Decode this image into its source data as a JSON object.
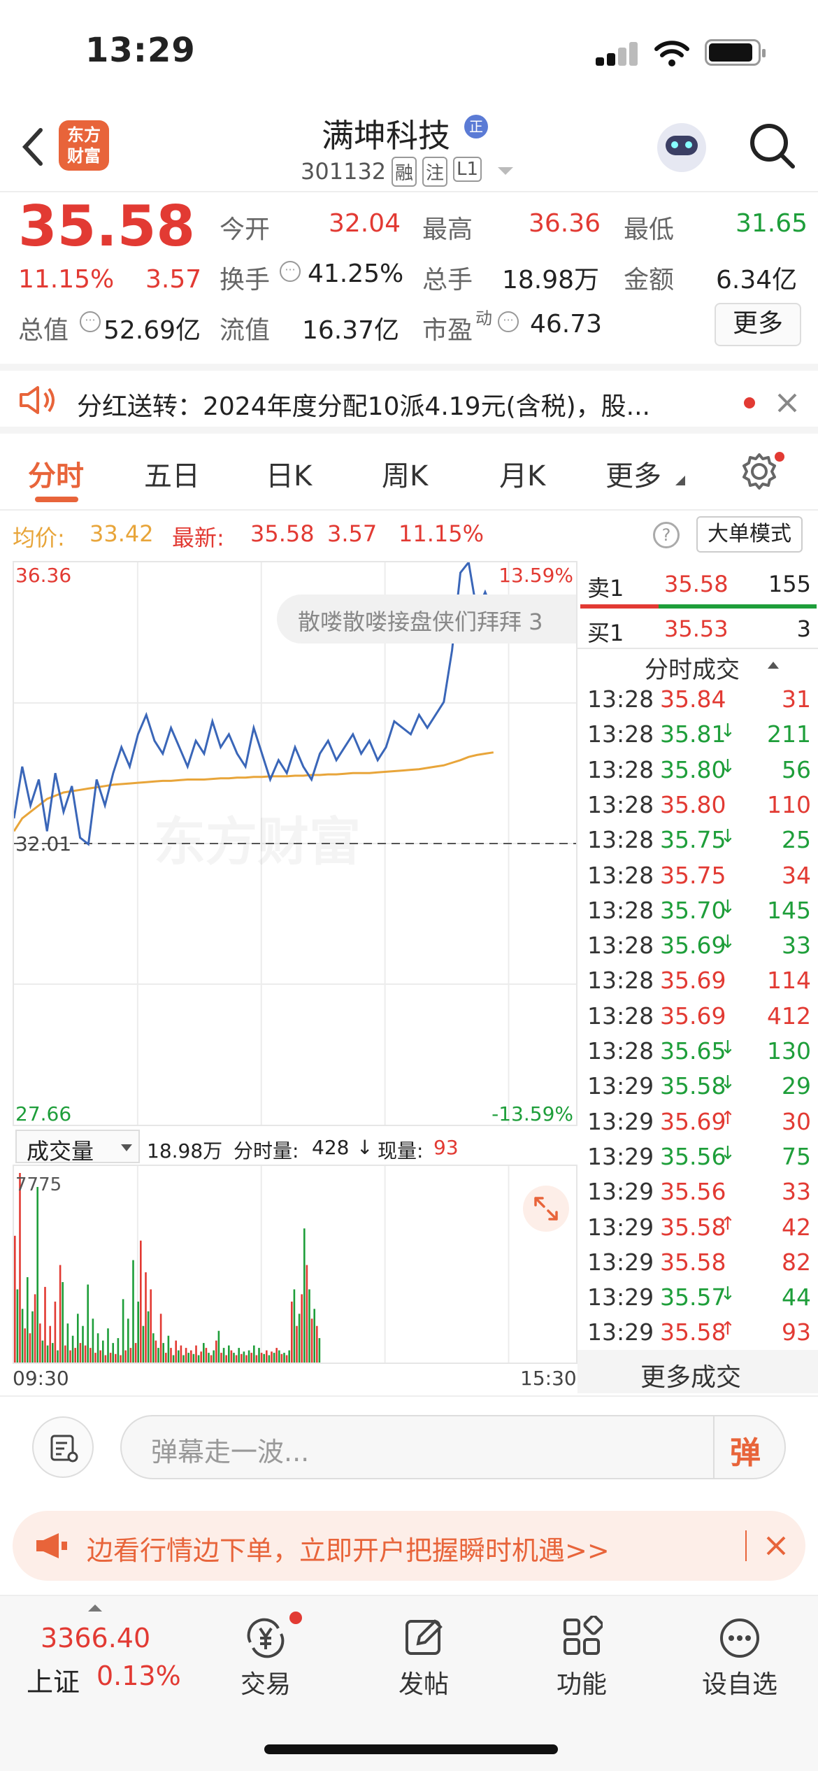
{
  "status_bar": {
    "time": "13:29"
  },
  "header": {
    "logo_text_line1": "东方",
    "logo_text_line2": "财富",
    "title": "满坤科技",
    "title_badge": "正",
    "code": "301132",
    "tags": [
      "融",
      "注",
      "L1"
    ]
  },
  "quote": {
    "price": "35.58",
    "change_pct": "11.15%",
    "change": "3.57",
    "open_label": "今开",
    "open": "32.04",
    "high_label": "最高",
    "high": "36.36",
    "low_label": "最低",
    "low": "31.65",
    "turnover_label": "换手",
    "turnover": "41.25%",
    "volume_label": "总手",
    "volume": "18.98万",
    "amount_label": "金额",
    "amount": "6.34亿",
    "mktcap_label": "总值",
    "mktcap": "52.69亿",
    "float_label": "流值",
    "float_cap": "16.37亿",
    "pe_label": "市盈",
    "pe_sup": "动",
    "pe": "46.73",
    "more_button": "更多"
  },
  "notice": {
    "text": "分红送转：2024年度分配10派4.19元(含税)，股..."
  },
  "tabs": [
    "分时",
    "五日",
    "日K",
    "周K",
    "月K",
    "更多"
  ],
  "price_bar": {
    "avg_label": "均价:",
    "avg": "33.42",
    "latest_label": "最新:",
    "latest": "35.58",
    "change": "3.57",
    "pct": "11.15%",
    "big_order_button": "大单模式"
  },
  "chart_labels": {
    "top_price": "36.36",
    "top_pct": "13.59%",
    "bottom_price": "27.66",
    "bottom_pct": "-13.59%",
    "prev_close": "32.01",
    "watermark": "东方财富",
    "danmu_float": "散喽散喽接盘侠们拜拜 3"
  },
  "chart_data": {
    "type": "line",
    "x_range": [
      "09:30",
      "15:30"
    ],
    "ylim": [
      27.66,
      36.36
    ],
    "prev_close": 32.01,
    "series": [
      {
        "name": "价格",
        "values": [
          32.4,
          33.2,
          32.6,
          33.0,
          32.2,
          33.1,
          32.5,
          32.9,
          32.1,
          32.0,
          33.0,
          32.6,
          33.1,
          33.5,
          33.2,
          33.7,
          34.0,
          33.6,
          33.4,
          33.8,
          33.5,
          33.2,
          33.6,
          33.4,
          33.9,
          33.5,
          33.7,
          33.4,
          33.2,
          33.8,
          33.4,
          33.0,
          33.3,
          33.1,
          33.5,
          33.2,
          33.0,
          33.4,
          33.6,
          33.3,
          33.5,
          33.7,
          33.4,
          33.6,
          33.3,
          33.5,
          33.9,
          33.8,
          33.7,
          34.0,
          33.8,
          34.0,
          34.2,
          35.0,
          36.2,
          36.36,
          35.6,
          35.9,
          35.58
        ]
      },
      {
        "name": "均价",
        "values": [
          32.2,
          32.4,
          32.5,
          32.6,
          32.7,
          32.75,
          32.8,
          32.82,
          32.84,
          32.86,
          32.88,
          32.9,
          32.92,
          32.93,
          32.94,
          32.95,
          32.96,
          32.97,
          32.98,
          32.98,
          32.99,
          33.0,
          33.0,
          33.0,
          33.01,
          33.02,
          33.02,
          33.03,
          33.03,
          33.04,
          33.04,
          33.05,
          33.05,
          33.05,
          33.06,
          33.06,
          33.07,
          33.07,
          33.08,
          33.08,
          33.09,
          33.1,
          33.1,
          33.1,
          33.11,
          33.12,
          33.13,
          33.14,
          33.15,
          33.16,
          33.18,
          33.2,
          33.22,
          33.26,
          33.3,
          33.35,
          33.38,
          33.4,
          33.42
        ]
      }
    ]
  },
  "volume": {
    "selector": "成交量",
    "total": "18.98万",
    "minute_label": "分时量:",
    "minute": "428",
    "arrow": "↓",
    "current_label": "现量:",
    "current": "93",
    "max": "7775",
    "start": "09:30",
    "end": "15:30"
  },
  "volume_data": {
    "ylim": [
      0,
      7775
    ],
    "values": [
      5200,
      3000,
      7775,
      2200,
      1400,
      3500,
      1200,
      2100,
      2800,
      7200,
      1600,
      900,
      3100,
      700,
      1500,
      800,
      2500,
      500,
      4000,
      3300,
      700,
      1600,
      500,
      1100,
      600,
      2000,
      800,
      1500,
      700,
      3200,
      600,
      1800,
      400,
      1200,
      500,
      900,
      300,
      1400,
      400,
      800,
      350,
      1000,
      300,
      2600,
      500,
      1800,
      600,
      4200,
      800,
      2500,
      5000,
      1500,
      3700,
      2100,
      3000,
      1200,
      900,
      600,
      2000,
      800,
      400,
      1100,
      600,
      300,
      900,
      500,
      700,
      300,
      600,
      400,
      500,
      350,
      700,
      300,
      450,
      800,
      600,
      400,
      300,
      500,
      900,
      1300,
      400,
      600,
      300,
      700,
      500,
      400,
      300,
      600,
      350,
      450,
      300,
      500,
      400,
      700,
      300,
      600,
      400,
      350,
      500,
      300,
      450,
      400,
      600,
      500,
      350,
      400,
      300,
      500,
      2500,
      3000,
      1500,
      2000,
      2800,
      5500,
      4000,
      3000,
      1800,
      2200,
      1500,
      1000
    ]
  },
  "order_book": {
    "sell_label": "卖1",
    "sell_price": "35.58",
    "sell_vol": "155",
    "buy_label": "买1",
    "buy_price": "35.53",
    "buy_vol": "3"
  },
  "trades_header": "分时成交",
  "trades": [
    {
      "t": "13:28",
      "p": "35.84",
      "a": "",
      "v": "31",
      "c": "red"
    },
    {
      "t": "13:28",
      "p": "35.81",
      "a": "↓",
      "v": "211",
      "c": "green"
    },
    {
      "t": "13:28",
      "p": "35.80",
      "a": "↓",
      "v": "56",
      "c": "green"
    },
    {
      "t": "13:28",
      "p": "35.80",
      "a": "",
      "v": "110",
      "c": "red"
    },
    {
      "t": "13:28",
      "p": "35.75",
      "a": "↓",
      "v": "25",
      "c": "green"
    },
    {
      "t": "13:28",
      "p": "35.75",
      "a": "",
      "v": "34",
      "c": "red"
    },
    {
      "t": "13:28",
      "p": "35.70",
      "a": "↓",
      "v": "145",
      "c": "green"
    },
    {
      "t": "13:28",
      "p": "35.69",
      "a": "↓",
      "v": "33",
      "c": "green"
    },
    {
      "t": "13:28",
      "p": "35.69",
      "a": "",
      "v": "114",
      "c": "red"
    },
    {
      "t": "13:28",
      "p": "35.69",
      "a": "",
      "v": "412",
      "c": "red"
    },
    {
      "t": "13:28",
      "p": "35.65",
      "a": "↓",
      "v": "130",
      "c": "green"
    },
    {
      "t": "13:29",
      "p": "35.58",
      "a": "↓",
      "v": "29",
      "c": "green"
    },
    {
      "t": "13:29",
      "p": "35.69",
      "a": "↑",
      "v": "30",
      "c": "red"
    },
    {
      "t": "13:29",
      "p": "35.56",
      "a": "↓",
      "v": "75",
      "c": "green"
    },
    {
      "t": "13:29",
      "p": "35.56",
      "a": "",
      "v": "33",
      "c": "red"
    },
    {
      "t": "13:29",
      "p": "35.58",
      "a": "↑",
      "v": "42",
      "c": "red"
    },
    {
      "t": "13:29",
      "p": "35.58",
      "a": "",
      "v": "82",
      "c": "red"
    },
    {
      "t": "13:29",
      "p": "35.57",
      "a": "↓",
      "v": "44",
      "c": "green"
    },
    {
      "t": "13:29",
      "p": "35.58",
      "a": "↑",
      "v": "93",
      "c": "red"
    }
  ],
  "more_trades": "更多成交",
  "danmu": {
    "placeholder": "弹幕走一波...",
    "send": "弹"
  },
  "ad": {
    "text": "边看行情边下单，立即开户把握瞬时机遇>>"
  },
  "bottom_nav": {
    "index_value": "3366.40",
    "index_name": "上证",
    "index_pct": "0.13%",
    "items": [
      "交易",
      "发帖",
      "功能",
      "设自选"
    ]
  },
  "colors": {
    "up": "#e23a33",
    "down": "#1e9e3a",
    "avg": "#e8a53a",
    "price_line": "#3a66b8",
    "accent": "#e8643a"
  }
}
